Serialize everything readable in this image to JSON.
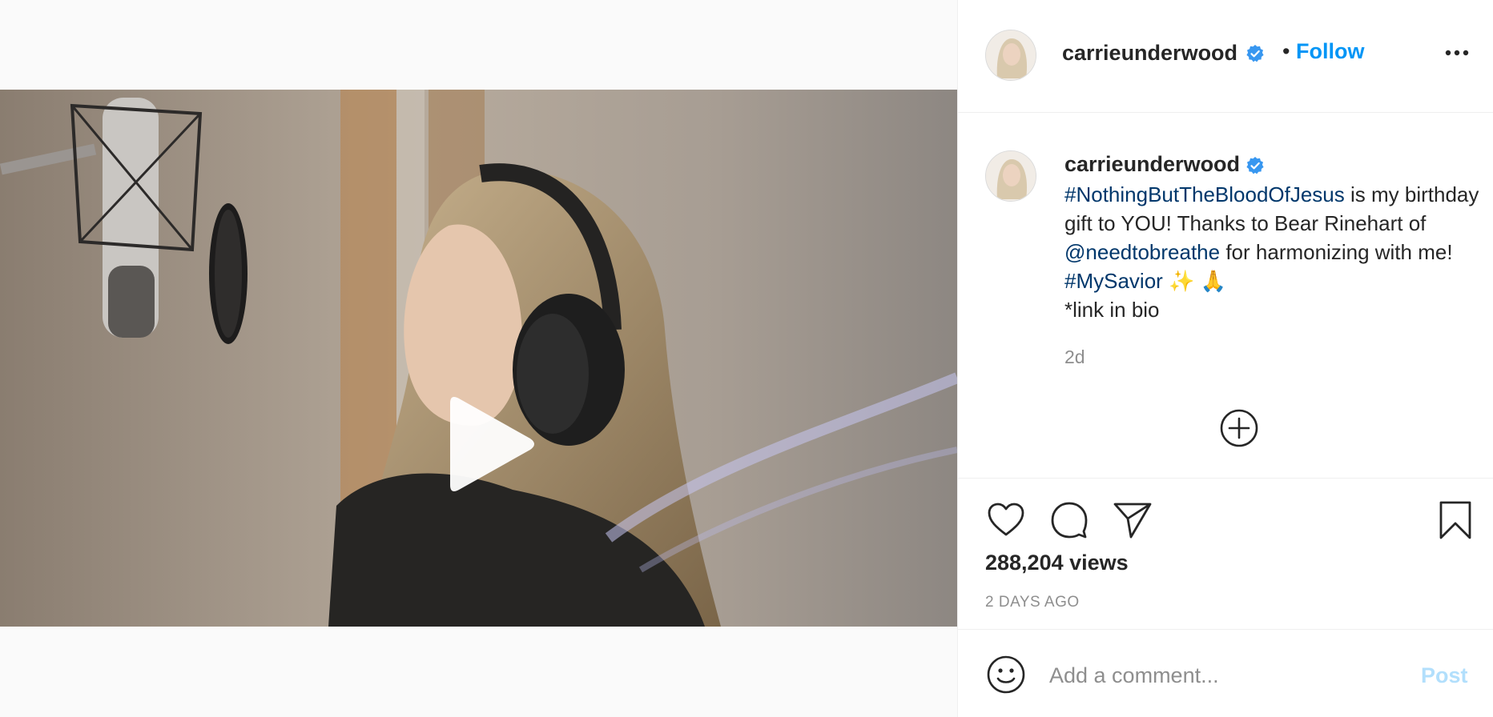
{
  "post": {
    "username": "carrieunderwood",
    "follow_label": "Follow",
    "separator": "•"
  },
  "caption": {
    "username": "carrieunderwood",
    "hashtag1": "#NothingButTheBloodOfJesus",
    "text1": " is my birthday gift to YOU! Thanks to Bear Rinehart of ",
    "mention": "@needtobreathe",
    "text2": " for harmonizing with me! ",
    "hashtag2": "#MySavior",
    "emoji": " ✨ 🙏",
    "text3": "*link in bio",
    "time": "2d"
  },
  "stats": {
    "views": "288,204 views",
    "posted": "2 DAYS AGO"
  },
  "comment": {
    "placeholder": "Add a comment...",
    "post_label": "Post"
  },
  "colors": {
    "accent": "#0095f6",
    "link": "#00376b",
    "muted": "#8e8e8e",
    "verified": "#3897f0",
    "post_disabled": "#b2dffc"
  },
  "icons": {
    "verified": "verified-badge-icon",
    "more": "more-options-icon",
    "load_more": "plus-circle-icon",
    "like": "heart-icon",
    "comment": "comment-bubble-icon",
    "share": "paper-plane-icon",
    "save": "bookmark-icon",
    "emoji": "smiley-icon",
    "play": "play-icon",
    "mute": "muted-speaker-icon"
  }
}
